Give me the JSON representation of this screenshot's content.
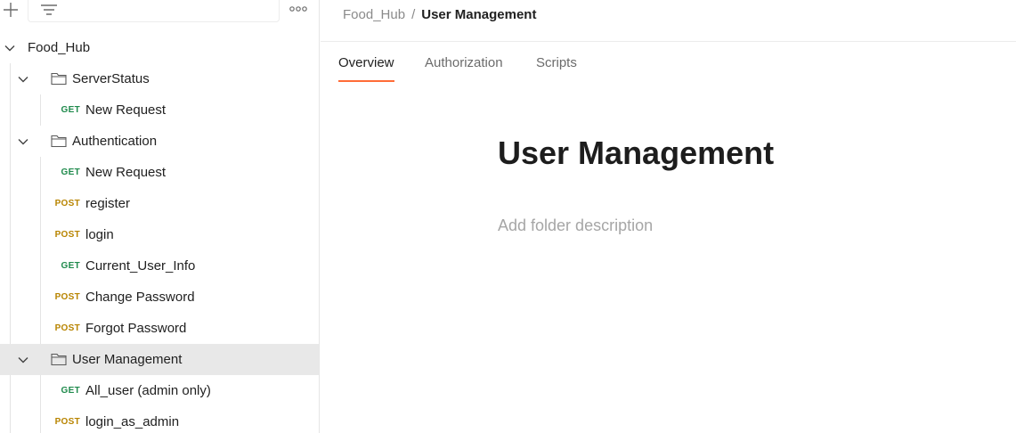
{
  "sidebar": {
    "toolbar": {
      "add_icon": "plus-icon",
      "filter_icon": "filter-icon",
      "more_icon": "more-horizontal-icon"
    },
    "collection": {
      "name": "Food_Hub"
    },
    "items": [
      {
        "kind": "folder",
        "label": "ServerStatus"
      },
      {
        "kind": "request",
        "method": "GET",
        "label": "New Request"
      },
      {
        "kind": "folder",
        "label": "Authentication"
      },
      {
        "kind": "request",
        "method": "GET",
        "label": "New Request"
      },
      {
        "kind": "request",
        "method": "POST",
        "label": "register"
      },
      {
        "kind": "request",
        "method": "POST",
        "label": "login"
      },
      {
        "kind": "request",
        "method": "GET",
        "label": "Current_User_Info"
      },
      {
        "kind": "request",
        "method": "POST",
        "label": "Change Password"
      },
      {
        "kind": "request",
        "method": "POST",
        "label": "Forgot Password"
      },
      {
        "kind": "folder",
        "label": "User Management",
        "selected": true
      },
      {
        "kind": "request",
        "method": "GET",
        "label": "All_user (admin only)"
      },
      {
        "kind": "request",
        "method": "POST",
        "label": "login_as_admin"
      }
    ]
  },
  "main": {
    "breadcrumb": {
      "root": "Food_Hub",
      "separator": "/",
      "current": "User Management"
    },
    "tabs": [
      {
        "label": "Overview",
        "active": true
      },
      {
        "label": "Authorization"
      },
      {
        "label": "Scripts"
      }
    ],
    "title": "User Management",
    "description_placeholder": "Add folder description"
  },
  "colors": {
    "accent": "#ff6c37",
    "get_method": "#1f8a4c",
    "post_method": "#b88400",
    "selected_row": "#e8e8e8"
  }
}
